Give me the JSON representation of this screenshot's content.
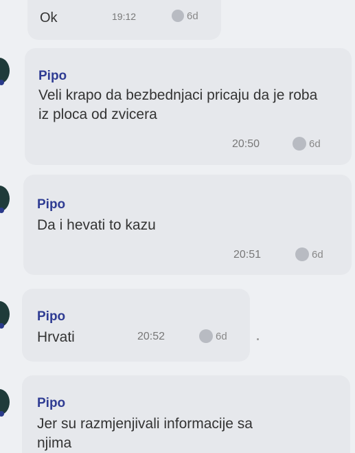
{
  "messages": [
    {
      "sender": "",
      "text": "Ok",
      "time": "19:12",
      "age": "6d"
    },
    {
      "sender": "Pipo",
      "text": "Veli krapo da bezbednjaci pricaju da je roba iz ploca od zvicera",
      "time": "20:50",
      "age": "6d"
    },
    {
      "sender": "Pipo",
      "text": "Da i hevati to kazu",
      "time": "20:51",
      "age": "6d"
    },
    {
      "sender": "Pipo",
      "text": "Hrvati",
      "time": "20:52",
      "age": "6d"
    },
    {
      "sender": "Pipo",
      "text": "Jer su razmjenjivali informacije sa njima",
      "time": "",
      "age": ""
    }
  ]
}
